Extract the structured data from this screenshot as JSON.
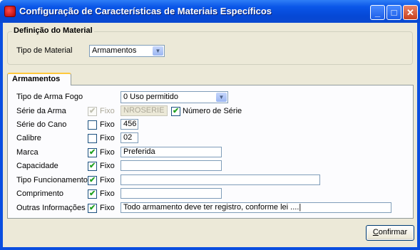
{
  "window": {
    "title": "Configuração de Características de Materiais Específicos",
    "buttons": {
      "minimize": "_",
      "maximize": "□",
      "close": "✕"
    }
  },
  "material_group": {
    "title": "Definição do Material",
    "tipo_label": "Tipo de Material",
    "tipo_value": "Armamentos"
  },
  "tab": {
    "label": "Armamentos"
  },
  "form": {
    "tipo_arma_fogo": {
      "label": "Tipo de Arma Fogo",
      "value": "0 Uso permitido"
    },
    "serie_arma": {
      "label": "Série da Arma",
      "fixo": "Fixo",
      "checked": true,
      "disabled": true,
      "value": "NROSERIE",
      "extra_label": "Número de Série",
      "extra_checked": true
    },
    "serie_cano": {
      "label": "Série do Cano",
      "fixo": "Fixo",
      "checked": false,
      "value": "456"
    },
    "calibre": {
      "label": "Calibre",
      "fixo": "Fixo",
      "checked": false,
      "value": "02"
    },
    "marca": {
      "label": "Marca",
      "fixo": "Fixo",
      "checked": true,
      "value": "Preferida"
    },
    "capacidade": {
      "label": "Capacidade",
      "fixo": "Fixo",
      "checked": true,
      "value": ""
    },
    "tipo_funcionamento": {
      "label": "Tipo Funcionamento",
      "fixo": "Fixo",
      "checked": true,
      "value": ""
    },
    "comprimento": {
      "label": "Comprimento",
      "fixo": "Fixo",
      "checked": true,
      "value": ""
    },
    "outras_informacoes": {
      "label": "Outras Informações",
      "fixo": "Fixo",
      "checked": true,
      "value": "Todo armamento deve ter registro, conforme lei ....|"
    }
  },
  "confirm_button": {
    "label_first": "C",
    "label_rest": "onfirmar"
  }
}
